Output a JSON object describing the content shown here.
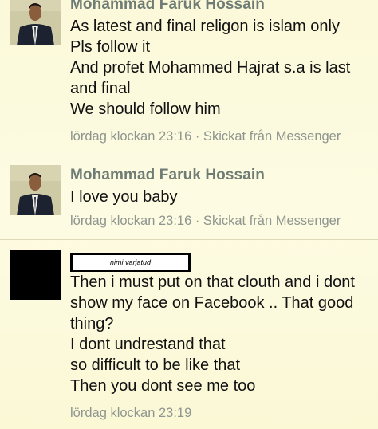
{
  "messages": [
    {
      "sender": "Mohammad Faruk Hossain",
      "lines": [
        "As latest and final religon is islam only",
        "Pls follow it",
        "And profet Mohammed Hajrat s.a is last",
        "and final",
        "We should follow him"
      ],
      "meta": "lördag klockan 23:16 · Skickat från Messenger"
    },
    {
      "sender": "Mohammad Faruk Hossain",
      "lines": [
        "I love you baby"
      ],
      "meta": "lördag klockan 23:16 · Skickat från Messenger"
    },
    {
      "sender_redacted_label": "nimi varjatud",
      "lines": [
        "Then i must put on that clouth and i dont",
        "show my face on Facebook .. That good",
        "thing?",
        "I dont undrestand that",
        "so difficult to be like that",
        "Then you dont see me too"
      ],
      "meta": "lördag klockan 23:19"
    }
  ],
  "colors": {
    "background": "#fdfbe0",
    "sender": "#6f7c76",
    "meta": "#8f968f",
    "text": "#111111",
    "divider": "#dcd8b8"
  }
}
